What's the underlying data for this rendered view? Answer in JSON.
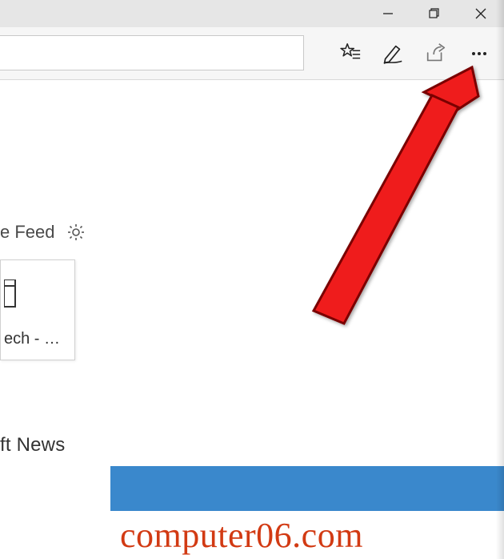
{
  "window": {
    "minimize_label": "Minimize",
    "maximize_label": "Restore",
    "close_label": "Close"
  },
  "toolbar": {
    "favorites_label": "Add to favorites or reading list",
    "notes_label": "Add notes",
    "share_label": "Share",
    "more_label": "Settings and more"
  },
  "page": {
    "feed_fragment": "e Feed",
    "gear_label": "Customize",
    "tile_label_fragment": "ech - …",
    "news_fragment": "ft News"
  },
  "watermark": {
    "text": "computer06.com"
  },
  "annotation": {
    "arrow_target": "settings-and-more"
  }
}
